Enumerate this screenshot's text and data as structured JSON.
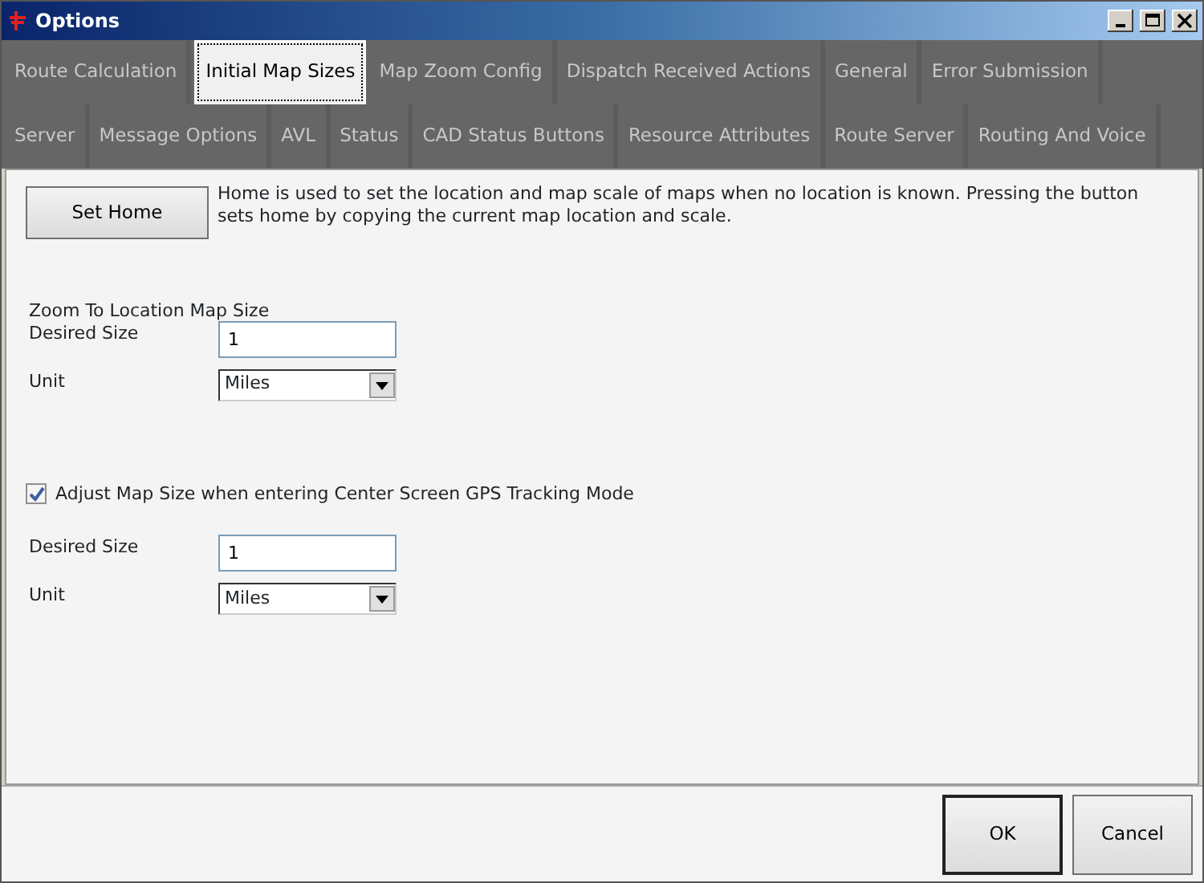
{
  "window": {
    "title": "Options"
  },
  "tab_rows": [
    {
      "tabs": [
        {
          "label": "Route Calculation",
          "selected": false
        },
        {
          "label": "Initial Map Sizes",
          "selected": true
        },
        {
          "label": "Map Zoom Config",
          "selected": false
        },
        {
          "label": "Dispatch Received Actions",
          "selected": false
        },
        {
          "label": "General",
          "selected": false
        },
        {
          "label": "Error Submission",
          "selected": false
        }
      ]
    },
    {
      "tabs": [
        {
          "label": "Server",
          "selected": false
        },
        {
          "label": "Message Options",
          "selected": false
        },
        {
          "label": "AVL",
          "selected": false
        },
        {
          "label": "Status",
          "selected": false
        },
        {
          "label": "CAD Status Buttons",
          "selected": false
        },
        {
          "label": "Resource Attributes",
          "selected": false
        },
        {
          "label": "Route Server",
          "selected": false
        },
        {
          "label": "Routing And Voice",
          "selected": false
        }
      ]
    }
  ],
  "home": {
    "button": "Set Home",
    "description": "Home is used to set the location and map scale of maps when no location is known.  Pressing the button sets home by copying the current map location and scale."
  },
  "zoom_to_location": {
    "heading": "Zoom To Location Map Size",
    "desired_size_label": "Desired Size",
    "desired_size": "1",
    "unit_label": "Unit",
    "unit": "Miles"
  },
  "gps_tracking": {
    "checkbox_label": "Adjust Map Size when entering Center Screen GPS Tracking Mode",
    "checked": true,
    "desired_size_label": "Desired Size",
    "desired_size": "1",
    "unit_label": "Unit",
    "unit": "Miles"
  },
  "buttons": [
    {
      "label": "OK",
      "default": true
    },
    {
      "label": "Cancel",
      "default": false
    }
  ]
}
